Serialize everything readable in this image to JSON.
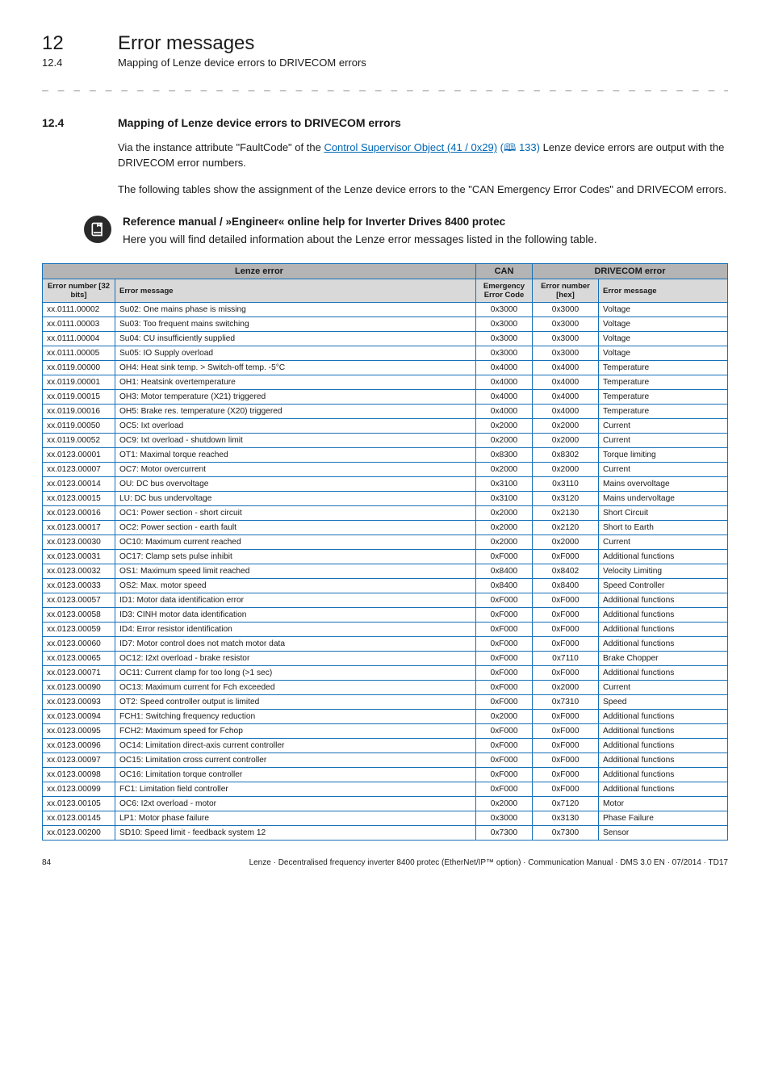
{
  "header": {
    "chapter_number": "12",
    "chapter_title": "Error messages",
    "sub_number": "12.4",
    "sub_title": "Mapping of Lenze device errors to DRIVECOM errors",
    "dashes": "_ _ _ _ _ _ _ _ _ _ _ _ _ _ _ _ _ _ _ _ _ _ _ _ _ _ _ _ _ _ _ _ _ _ _ _ _ _ _ _ _ _ _ _ _ _ _ _ _ _ _ _ _ _ _ _ _ _ _ _ _ _ _ _"
  },
  "section": {
    "num": "12.4",
    "title": "Mapping of Lenze device errors to DRIVECOM errors",
    "intro_prefix": "Via the instance attribute \"FaultCode\" of the ",
    "intro_link": "Control Supervisor Object (41 / 0x29)",
    "intro_ref_icon": "📖",
    "intro_ref_page": "133",
    "intro_suffix": " Lenze device errors are output with the DRIVECOM error numbers.",
    "para2": "The following tables show the assignment of the Lenze device errors to the \"CAN Emergency Error Codes\" and DRIVECOM errors."
  },
  "reference": {
    "title": "Reference manual / »Engineer« online help for Inverter Drives 8400 protec",
    "body": "Here you will find detailed information about the Lenze error messages listed in the following table."
  },
  "table": {
    "headers": {
      "lenze": "Lenze error",
      "can": "CAN",
      "drivecom": "DRIVECOM error",
      "errnum": "Error number\n[32 bits]",
      "errmsg": "Error message",
      "emerg": "Emergency\nError Code",
      "errnum_hex": "Error number\n[hex]",
      "errmsg2": "Error message"
    },
    "rows": [
      {
        "num": "xx.0111.00002",
        "msg": "Su02: One mains phase is missing",
        "can": "0x3000",
        "hex": "0x3000",
        "dmsg": "Voltage"
      },
      {
        "num": "xx.0111.00003",
        "msg": "Su03: Too frequent mains switching",
        "can": "0x3000",
        "hex": "0x3000",
        "dmsg": "Voltage"
      },
      {
        "num": "xx.0111.00004",
        "msg": "Su04: CU insufficiently supplied",
        "can": "0x3000",
        "hex": "0x3000",
        "dmsg": "Voltage"
      },
      {
        "num": "xx.0111.00005",
        "msg": "Su05: IO Supply overload",
        "can": "0x3000",
        "hex": "0x3000",
        "dmsg": "Voltage"
      },
      {
        "num": "xx.0119.00000",
        "msg": "OH4: Heat sink temp. > Switch-off temp. -5°C",
        "can": "0x4000",
        "hex": "0x4000",
        "dmsg": "Temperature"
      },
      {
        "num": "xx.0119.00001",
        "msg": "OH1: Heatsink overtemperature",
        "can": "0x4000",
        "hex": "0x4000",
        "dmsg": "Temperature"
      },
      {
        "num": "xx.0119.00015",
        "msg": "OH3: Motor temperature (X21) triggered",
        "can": "0x4000",
        "hex": "0x4000",
        "dmsg": "Temperature"
      },
      {
        "num": "xx.0119.00016",
        "msg": "OH5: Brake res. temperature (X20) triggered",
        "can": "0x4000",
        "hex": "0x4000",
        "dmsg": "Temperature"
      },
      {
        "num": "xx.0119.00050",
        "msg": "OC5: Ixt overload",
        "can": "0x2000",
        "hex": "0x2000",
        "dmsg": "Current"
      },
      {
        "num": "xx.0119.00052",
        "msg": "OC9: Ixt overload - shutdown limit",
        "can": "0x2000",
        "hex": "0x2000",
        "dmsg": "Current"
      },
      {
        "num": "xx.0123.00001",
        "msg": "OT1: Maximal torque reached",
        "can": "0x8300",
        "hex": "0x8302",
        "dmsg": "Torque limiting"
      },
      {
        "num": "xx.0123.00007",
        "msg": "OC7: Motor overcurrent",
        "can": "0x2000",
        "hex": "0x2000",
        "dmsg": "Current"
      },
      {
        "num": "xx.0123.00014",
        "msg": "OU: DC bus overvoltage",
        "can": "0x3100",
        "hex": "0x3110",
        "dmsg": "Mains overvoltage"
      },
      {
        "num": "xx.0123.00015",
        "msg": "LU: DC bus undervoltage",
        "can": "0x3100",
        "hex": "0x3120",
        "dmsg": "Mains undervoltage"
      },
      {
        "num": "xx.0123.00016",
        "msg": "OC1: Power section - short circuit",
        "can": "0x2000",
        "hex": "0x2130",
        "dmsg": "Short Circuit"
      },
      {
        "num": "xx.0123.00017",
        "msg": "OC2: Power section - earth fault",
        "can": "0x2000",
        "hex": "0x2120",
        "dmsg": "Short to Earth"
      },
      {
        "num": "xx.0123.00030",
        "msg": "OC10: Maximum current reached",
        "can": "0x2000",
        "hex": "0x2000",
        "dmsg": "Current"
      },
      {
        "num": "xx.0123.00031",
        "msg": "OC17: Clamp sets pulse inhibit",
        "can": "0xF000",
        "hex": "0xF000",
        "dmsg": "Additional functions"
      },
      {
        "num": "xx.0123.00032",
        "msg": "OS1: Maximum speed limit reached",
        "can": "0x8400",
        "hex": "0x8402",
        "dmsg": "Velocity Limiting"
      },
      {
        "num": "xx.0123.00033",
        "msg": "OS2: Max. motor speed",
        "can": "0x8400",
        "hex": "0x8400",
        "dmsg": "Speed Controller"
      },
      {
        "num": "xx.0123.00057",
        "msg": "ID1: Motor data identification error",
        "can": "0xF000",
        "hex": "0xF000",
        "dmsg": "Additional functions"
      },
      {
        "num": "xx.0123.00058",
        "msg": "ID3: CINH motor data identification",
        "can": "0xF000",
        "hex": "0xF000",
        "dmsg": "Additional functions"
      },
      {
        "num": "xx.0123.00059",
        "msg": "ID4: Error resistor identification",
        "can": "0xF000",
        "hex": "0xF000",
        "dmsg": "Additional functions"
      },
      {
        "num": "xx.0123.00060",
        "msg": "ID7: Motor control does not match motor data",
        "can": "0xF000",
        "hex": "0xF000",
        "dmsg": "Additional functions"
      },
      {
        "num": "xx.0123.00065",
        "msg": "OC12: I2xt overload - brake resistor",
        "can": "0xF000",
        "hex": "0x7110",
        "dmsg": "Brake Chopper"
      },
      {
        "num": "xx.0123.00071",
        "msg": "OC11: Current clamp for too long (>1 sec)",
        "can": "0xF000",
        "hex": "0xF000",
        "dmsg": "Additional functions"
      },
      {
        "num": "xx.0123.00090",
        "msg": "OC13: Maximum current for Fch exceeded",
        "can": "0xF000",
        "hex": "0x2000",
        "dmsg": "Current"
      },
      {
        "num": "xx.0123.00093",
        "msg": "OT2: Speed controller output is limited",
        "can": "0xF000",
        "hex": "0x7310",
        "dmsg": "Speed"
      },
      {
        "num": "xx.0123.00094",
        "msg": "FCH1: Switching frequency reduction",
        "can": "0x2000",
        "hex": "0xF000",
        "dmsg": "Additional functions"
      },
      {
        "num": "xx.0123.00095",
        "msg": "FCH2: Maximum speed for Fchop",
        "can": "0xF000",
        "hex": "0xF000",
        "dmsg": "Additional functions"
      },
      {
        "num": "xx.0123.00096",
        "msg": "OC14: Limitation direct-axis current controller",
        "can": "0xF000",
        "hex": "0xF000",
        "dmsg": "Additional functions"
      },
      {
        "num": "xx.0123.00097",
        "msg": "OC15: Limitation cross current controller",
        "can": "0xF000",
        "hex": "0xF000",
        "dmsg": "Additional functions"
      },
      {
        "num": "xx.0123.00098",
        "msg": "OC16: Limitation torque controller",
        "can": "0xF000",
        "hex": "0xF000",
        "dmsg": "Additional functions"
      },
      {
        "num": "xx.0123.00099",
        "msg": "FC1: Limitation field controller",
        "can": "0xF000",
        "hex": "0xF000",
        "dmsg": "Additional functions"
      },
      {
        "num": "xx.0123.00105",
        "msg": "OC6: I2xt overload - motor",
        "can": "0x2000",
        "hex": "0x7120",
        "dmsg": "Motor"
      },
      {
        "num": "xx.0123.00145",
        "msg": "LP1: Motor phase failure",
        "can": "0x3000",
        "hex": "0x3130",
        "dmsg": "Phase Failure"
      },
      {
        "num": "xx.0123.00200",
        "msg": "SD10: Speed limit - feedback system 12",
        "can": "0x7300",
        "hex": "0x7300",
        "dmsg": "Sensor"
      }
    ]
  },
  "footer": {
    "page": "84",
    "text": "Lenze · Decentralised frequency inverter 8400 protec (EtherNet/IP™ option) · Communication Manual · DMS 3.0 EN · 07/2014 · TD17"
  }
}
